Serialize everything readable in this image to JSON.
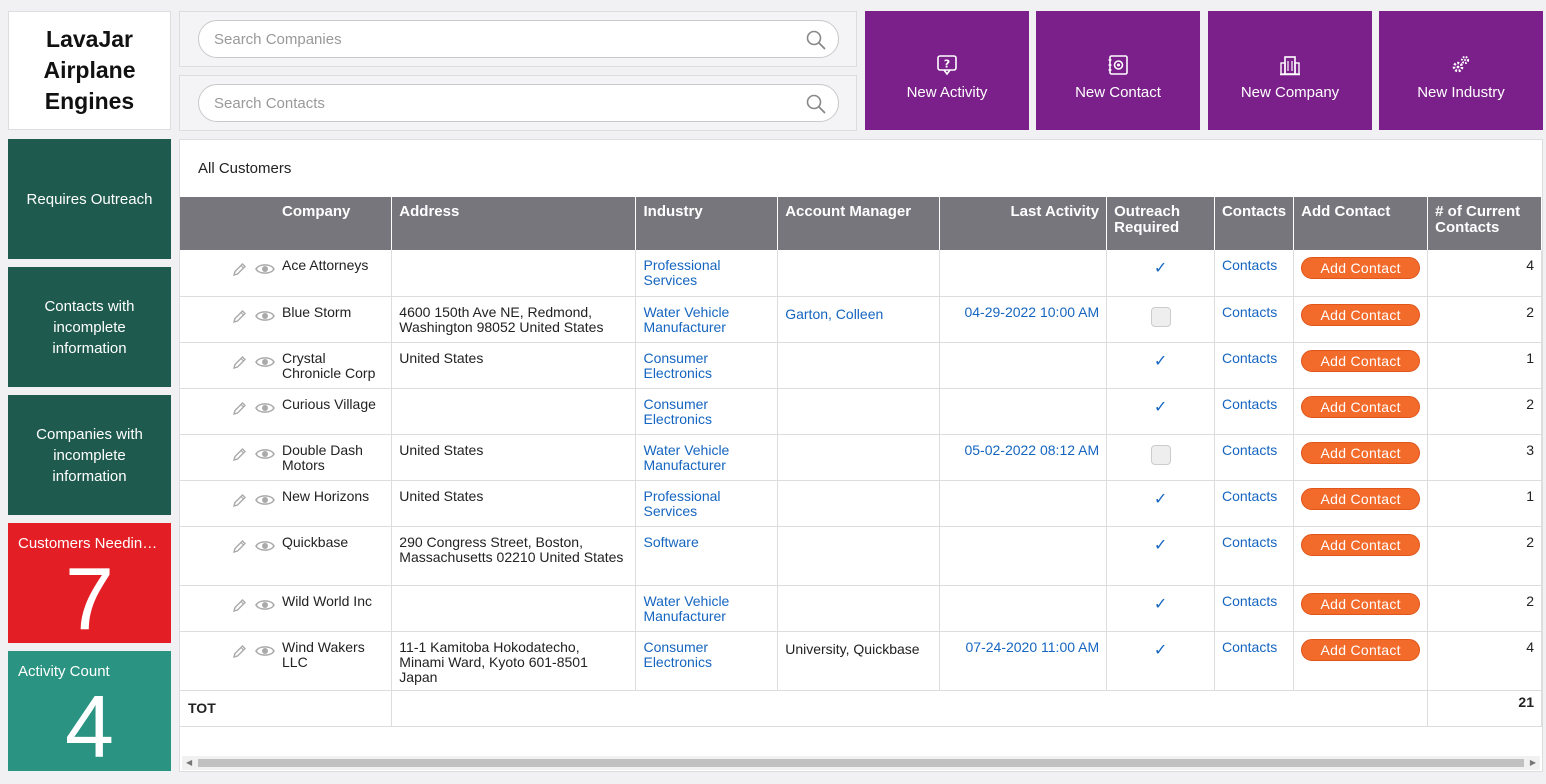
{
  "app": {
    "title": "LavaJar\nAirplane\nEngines"
  },
  "search": {
    "companies_placeholder": "Search Companies",
    "contacts_placeholder": "Search Contacts"
  },
  "actions": [
    {
      "label": "New Activity",
      "icon": "question-bubble-icon"
    },
    {
      "label": "New Contact",
      "icon": "contact-card-icon"
    },
    {
      "label": "New Company",
      "icon": "building-icon"
    },
    {
      "label": "New Industry",
      "icon": "gears-icon"
    }
  ],
  "sidebar": {
    "requires_outreach": "Requires Outreach",
    "contacts_incomplete": "Contacts with incomplete information",
    "companies_incomplete": "Companies with incomplete information",
    "customers_needing": {
      "title": "Customers Needing Outreach",
      "count": "7"
    },
    "activity_count": {
      "title": "Activity Count",
      "count": "4"
    }
  },
  "colors": {
    "action_purple": "#7b1f8a",
    "sidebar_green": "#1e5a4e",
    "alert_red": "#e31e24",
    "teal": "#2a9381",
    "header_gray": "#77767d",
    "button_orange": "#f36b2b",
    "link_blue": "#1565c0"
  },
  "report": {
    "title": "All Customers",
    "columns": [
      "Company",
      "Address",
      "Industry",
      "Account Manager",
      "Last Activity",
      "Outreach Required",
      "Contacts",
      "Add Contact",
      "# of Current Contacts"
    ],
    "rows": [
      {
        "company": "Ace Attorneys",
        "address": "",
        "industry": "Professional Services",
        "manager": "",
        "last_activity": "",
        "outreach": true,
        "contacts": "Contacts",
        "add": "Add Contact",
        "count": "4"
      },
      {
        "company": "Blue Storm",
        "address": "4600 150th Ave NE, Redmond, Washington 98052 United States",
        "industry": "Water Vehicle Manufacturer",
        "manager": "Garton, Colleen",
        "last_activity": "04-29-2022 10:00 AM",
        "outreach": false,
        "contacts": "Contacts",
        "add": "Add Contact",
        "count": "2"
      },
      {
        "company": "Crystal Chronicle Corp",
        "address": "United States",
        "industry": "Consumer Electronics",
        "manager": "",
        "last_activity": "",
        "outreach": true,
        "contacts": "Contacts",
        "add": "Add Contact",
        "count": "1"
      },
      {
        "company": "Curious Village",
        "address": "",
        "industry": "Consumer Electronics",
        "manager": "",
        "last_activity": "",
        "outreach": true,
        "contacts": "Contacts",
        "add": "Add Contact",
        "count": "2"
      },
      {
        "company": "Double Dash Motors",
        "address": "United States",
        "industry": "Water Vehicle Manufacturer",
        "manager": "",
        "last_activity": "05-02-2022 08:12 AM",
        "outreach": false,
        "contacts": "Contacts",
        "add": "Add Contact",
        "count": "3"
      },
      {
        "company": "New Horizons",
        "address": "United States",
        "industry": "Professional Services",
        "manager": "",
        "last_activity": "",
        "outreach": true,
        "contacts": "Contacts",
        "add": "Add Contact",
        "count": "1"
      },
      {
        "company": "Quickbase",
        "address": "290 Congress Street, Boston, Massachusetts 02210 United States",
        "industry": "Software",
        "manager": "",
        "last_activity": "",
        "outreach": true,
        "contacts": "Contacts",
        "add": "Add Contact",
        "count": "2"
      },
      {
        "company": "Wild World Inc",
        "address": "",
        "industry": "Water Vehicle Manufacturer",
        "manager": "",
        "last_activity": "",
        "outreach": true,
        "contacts": "Contacts",
        "add": "Add Contact",
        "count": "2"
      },
      {
        "company": "Wind Wakers LLC",
        "address": "11-1 Kamitoba Hokodatecho, Minami Ward, Kyoto 601-8501 Japan",
        "industry": "Consumer Electronics",
        "manager": "University, Quickbase",
        "manager_red": true,
        "last_activity": "07-24-2020 11:00 AM",
        "outreach": true,
        "contacts": "Contacts",
        "add": "Add Contact",
        "count": "4"
      }
    ],
    "totals": {
      "label": "TOT",
      "value": "21"
    }
  }
}
